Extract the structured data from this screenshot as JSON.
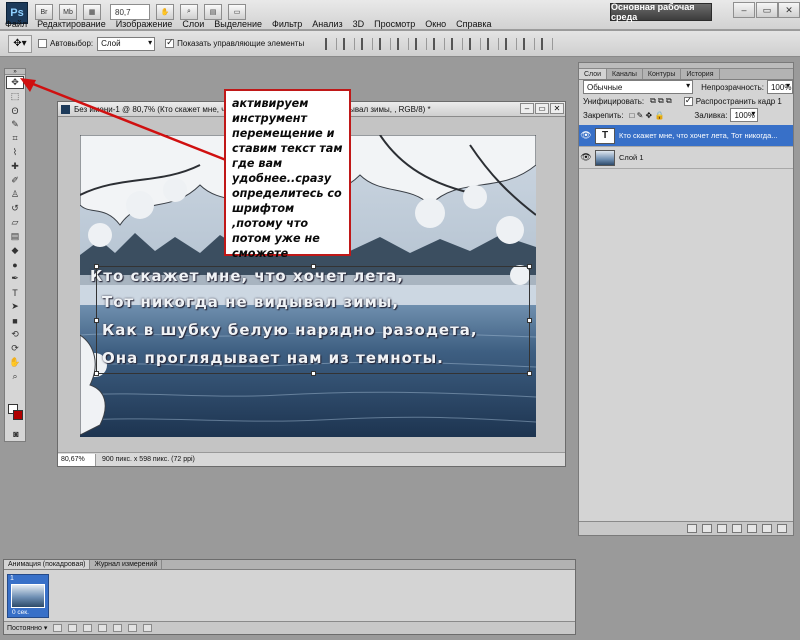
{
  "app": {
    "logo": "Ps",
    "zoom_value": "80,7",
    "workspace_label": "Основная рабочая среда",
    "menus": [
      "Файл",
      "Редактирование",
      "Изображение",
      "Слои",
      "Выделение",
      "Фильтр",
      "Анализ",
      "3D",
      "Просмотр",
      "Окно",
      "Справка"
    ]
  },
  "options": {
    "autoselect_label": "Автовыбор:",
    "autoselect_value": "Слой",
    "show_controls_label": "Показать управляющие элементы"
  },
  "document": {
    "title": "Без имени-1 @ 80,7% (Кто скажет мне, что хочет лета, Тот никогда не видывал зимы, , RGB/8) *",
    "status_zoom": "80,67%",
    "status_info": "900 пикс. x 598 пикс. (72 ppi)",
    "text_lines": [
      "Кто скажет мне, что хочет лета,",
      "Тот никогда не видывал зимы,",
      "Как в шубку белую нарядно разодета,",
      "Она проглядывает нам из темноты."
    ]
  },
  "annotation": {
    "text": "активируем инструмент перемещение и ставим текст там где вам удобнее..сразу определитесь со шрифтом ,потому что потом уже не сможете"
  },
  "layers_panel": {
    "tabs": [
      "Слои",
      "Каналы",
      "Контуры",
      "История"
    ],
    "blend_mode": "Обычные",
    "opacity_label": "Непрозрачность:",
    "opacity_value": "100%",
    "unify_label": "Унифицировать:",
    "propagate_label": "Распространить кадр 1",
    "lock_label": "Закрепить:",
    "fill_label": "Заливка:",
    "fill_value": "100%",
    "layers": [
      {
        "name": "Кто скажет мне, что хочет лета,   Тот никогда...",
        "kind": "T",
        "selected": true
      },
      {
        "name": "Слой 1",
        "kind": "image",
        "selected": false
      }
    ]
  },
  "animation_panel": {
    "tabs": [
      "Анимация (покадровая)",
      "Журнал измерений"
    ],
    "frame_number": "1",
    "frame_duration": "0 сек.",
    "loop_label": "Постоянно"
  },
  "colors": {
    "annotation_border": "#c01818",
    "arrow": "#d01010",
    "selection_blue": "#3870c8"
  }
}
